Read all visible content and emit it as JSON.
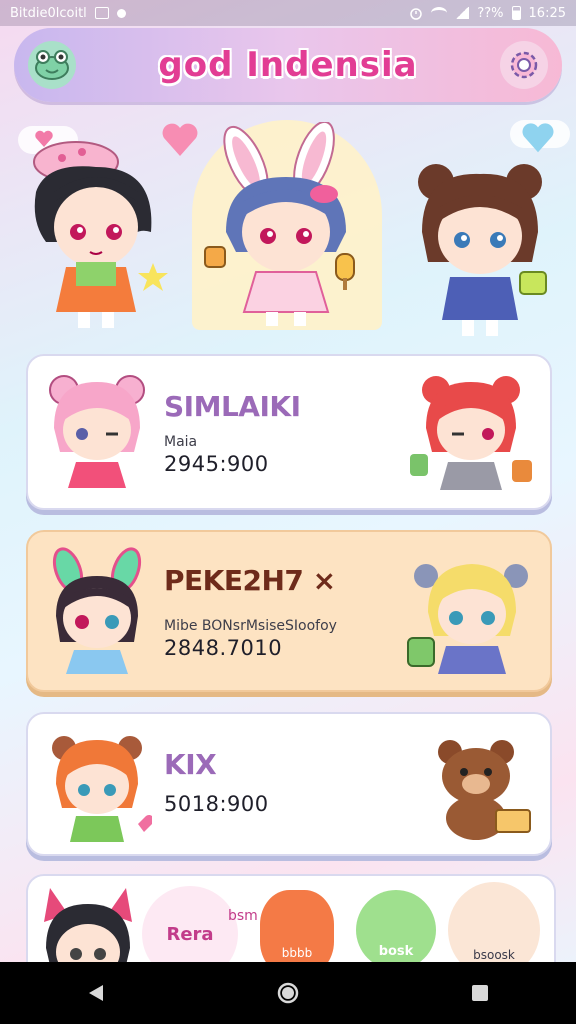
{
  "status_bar": {
    "left_text": "Bitdie0lcoitl",
    "time": "16:25",
    "network": "??%",
    "icons": [
      "image-icon",
      "record-icon",
      "alarm-icon",
      "wifi-icon",
      "signal-icon",
      "battery-icon"
    ]
  },
  "header": {
    "title": "god Indensia",
    "left_icon": "frog-face-icon",
    "right_icon": "gear-icon"
  },
  "hero": {
    "characters": [
      "girl-with-hat",
      "bunny-girl",
      "bear-eared-girl"
    ]
  },
  "cards": [
    {
      "name": "SIMLAIKI",
      "sub": "Maia",
      "score": "2945:900"
    },
    {
      "name": "PEKE2H7 ×",
      "sub": "Mibe BONsrMsiseSIoofoy",
      "score": "2848.7010"
    },
    {
      "name": "KIX",
      "sub": "",
      "score": "5018:900"
    }
  ],
  "bottom_card": {
    "labels": [
      "Rera",
      "bsm",
      "bbbb",
      "bosk",
      "bsoosk"
    ]
  },
  "nav": {
    "back": "back-icon",
    "home": "home-icon",
    "recents": "recents-icon"
  },
  "colors": {
    "title": "#e23d94",
    "name_purple": "#9b6ab8",
    "name_brown": "#6e2b1b",
    "card_peach": "#fde3c2"
  }
}
